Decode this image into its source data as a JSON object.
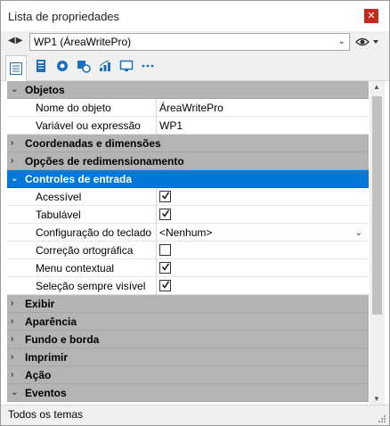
{
  "window": {
    "title": "Lista de propriedades",
    "close_glyph": "✕"
  },
  "objectbar": {
    "selected": "WP1 (ÁreaWritePro)",
    "nav_glyph": "◀▶"
  },
  "toolbar": {
    "icons": [
      "list-icon",
      "form-icon",
      "gear-icon",
      "objects-icon",
      "chart-icon",
      "monitor-icon",
      "more-icon"
    ]
  },
  "sections": {
    "objetos": {
      "label": "Objetos",
      "expanded": true
    },
    "coordenadas": {
      "label": "Coordenadas e dimensões",
      "expanded": false
    },
    "redimensionamento": {
      "label": "Opções de redimensionamento",
      "expanded": false
    },
    "controles": {
      "label": "Controles de entrada",
      "expanded": true
    },
    "exibir": {
      "label": "Exibir",
      "expanded": false
    },
    "aparencia": {
      "label": "Aparência",
      "expanded": false
    },
    "fundo": {
      "label": "Fundo e borda",
      "expanded": false
    },
    "imprimir": {
      "label": "Imprimir",
      "expanded": false
    },
    "acao": {
      "label": "Ação",
      "expanded": false
    },
    "eventos": {
      "label": "Eventos",
      "expanded": true
    }
  },
  "props": {
    "nome": {
      "name": "Nome do objeto",
      "value": "ÁreaWritePro"
    },
    "variavel": {
      "name": "Variável ou expressão",
      "value": "WP1"
    },
    "acessivel": {
      "name": "Acessível",
      "checked": true
    },
    "tabulavel": {
      "name": "Tabulável",
      "checked": true
    },
    "teclado": {
      "name": "Configuração do teclado",
      "value": "<Nenhum>"
    },
    "correcao": {
      "name": "Correção ortográfica",
      "checked": false
    },
    "menu": {
      "name": "Menu contextual",
      "checked": true
    },
    "selecao": {
      "name": "Seleção sempre visível",
      "checked": true
    }
  },
  "glyphs": {
    "expanded": "⌄",
    "collapsed": "›",
    "chevron_down": "⌄"
  },
  "status": {
    "text": "Todos os temas"
  },
  "colors": {
    "selected_section": "#0078d7",
    "section": "#b4b4b4",
    "close": "#c42b1c"
  }
}
